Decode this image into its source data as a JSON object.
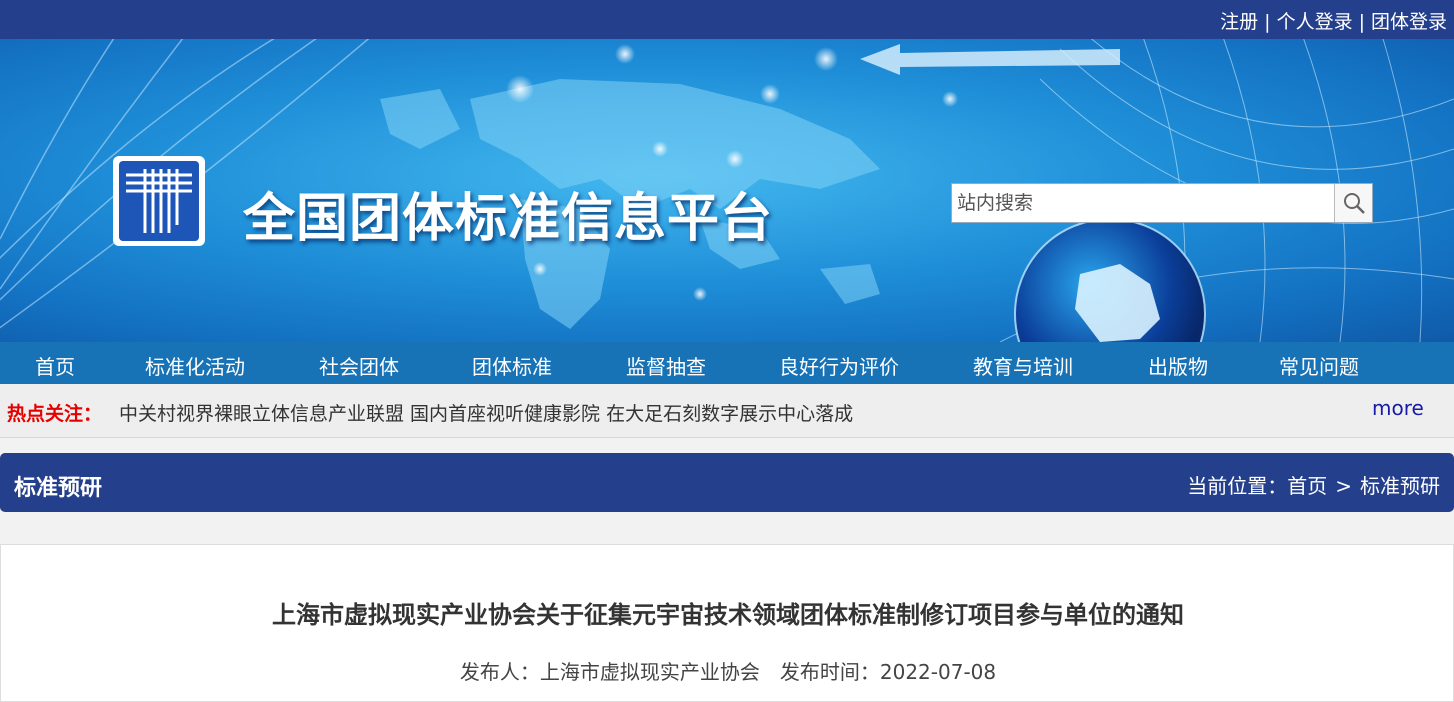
{
  "top_links": [
    "注册",
    "个人登录",
    "团体登录"
  ],
  "top_separator": "|",
  "site": {
    "title": "全国团体标准信息平台"
  },
  "search": {
    "placeholder": "站内搜索"
  },
  "nav": [
    "首页",
    "标准化活动",
    "社会团体",
    "团体标准",
    "监督抽查",
    "良好行为评价",
    "教育与培训",
    "出版物",
    "常见问题"
  ],
  "hot": {
    "label": "热点关注：",
    "text": "中关村视界裸眼立体信息产业联盟 国内首座视听健康影院 在大足石刻数字展示中心落成",
    "more": "more"
  },
  "section": {
    "title": "标准预研",
    "breadcrumb_prefix": "当前位置：",
    "breadcrumb": [
      "首页",
      "标准预研"
    ],
    "breadcrumb_sep": ">"
  },
  "article": {
    "title": "上海市虚拟现实产业协会关于征集元宇宙技术领域团体标准制修订项目参与单位的通知",
    "publisher_label": "发布人：",
    "publisher": "上海市虚拟现实产业协会",
    "date_label": "发布时间：",
    "date": "2022-07-08"
  },
  "colors": {
    "topbar": "#243f8c",
    "nav": "#1872b6",
    "hot_label": "#e60000",
    "more_link": "#1a1aa8",
    "section_header": "#243f8c"
  },
  "icons": {
    "search": "magnifier-icon",
    "logo": "standards-logo-icon"
  }
}
